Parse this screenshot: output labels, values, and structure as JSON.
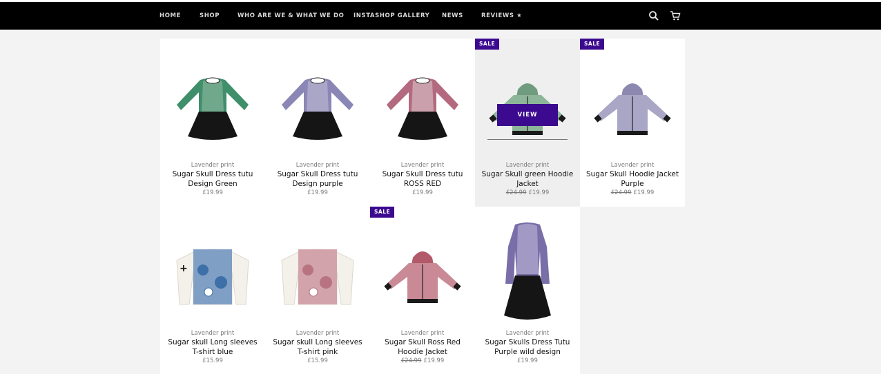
{
  "nav": {
    "items": [
      {
        "label": "HOME"
      },
      {
        "label": "SHOP"
      },
      {
        "label": "WHO ARE WE & WHAT WE DO"
      },
      {
        "label": "INSTASHOP GALLERY"
      },
      {
        "label": "NEWS"
      },
      {
        "label": "REVIEWS ★"
      }
    ],
    "icons": [
      "search-icon",
      "cart-icon"
    ]
  },
  "products": [
    {
      "vendor": "Lavender print",
      "title": "Sugar Skull Dress tutu Design Green",
      "price": "£19.99",
      "old_price": "",
      "sale": "",
      "kind": "dress",
      "sleeve": "#3f8f6a",
      "bodice": "#6fa88b"
    },
    {
      "vendor": "Lavender print",
      "title": "Sugar Skull Dress tutu Design purple",
      "price": "£19.99",
      "old_price": "",
      "sale": "",
      "kind": "dress",
      "sleeve": "#8a86b5",
      "bodice": "#a9a6c8"
    },
    {
      "vendor": "Lavender print",
      "title": "Sugar Skull Dress tutu ROSS RED",
      "price": "£19.99",
      "old_price": "",
      "sale": "",
      "kind": "dress",
      "sleeve": "#b46a7e",
      "bodice": "#caa0ad"
    },
    {
      "vendor": "Lavender print",
      "title": "Sugar Skull green Hoodie Jacket",
      "price": "£19.99",
      "old_price": "£24.99",
      "sale": "SALE",
      "kind": "hoodie",
      "sleeve": "#6f9b7f",
      "bodice": "#8db59a",
      "hover": true,
      "view_label": "VIEW"
    },
    {
      "vendor": "Lavender print",
      "title": "Sugar Skull Hoodie Jacket Purple",
      "price": "£19.99",
      "old_price": "£24.99",
      "sale": "SALE",
      "kind": "hoodie",
      "sleeve": "#8c88b0",
      "bodice": "#aaa7c6"
    },
    {
      "vendor": "Lavender print",
      "title": "Sugar skull Long sleeves T-shirt blue",
      "price": "£15.99",
      "old_price": "",
      "sale": "",
      "kind": "tee",
      "sleeve": "#3d6fa8",
      "bodice": "#7f9fc5"
    },
    {
      "vendor": "Lavender print",
      "title": "Sugar skull Long sleeves T-shirt pink",
      "price": "£15.99",
      "old_price": "",
      "sale": "",
      "kind": "tee",
      "sleeve": "#b87380",
      "bodice": "#d3a3ab"
    },
    {
      "vendor": "Lavender print",
      "title": "Sugar Skull Ross Red Hoodie Jacket",
      "price": "£19.99",
      "old_price": "£24.99",
      "sale": "SALE",
      "kind": "hoodie",
      "sleeve": "#b25a6a",
      "bodice": "#c98a96"
    },
    {
      "vendor": "Lavender print",
      "title": "Sugar Skulls Dress Tutu Purple wild design",
      "price": "£19.99",
      "old_price": "",
      "sale": "",
      "kind": "longdress",
      "sleeve": "#7a6ea8",
      "bodice": "#a299c4"
    }
  ],
  "colors": {
    "nav_bg": "#000000",
    "accent": "#3b0a8f",
    "page_bg": "#f3f3f3"
  }
}
